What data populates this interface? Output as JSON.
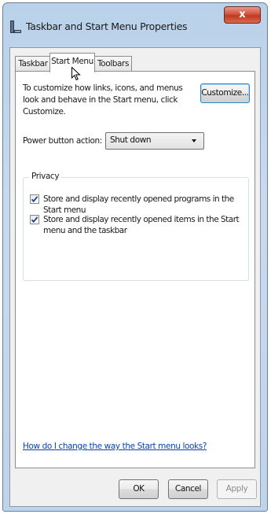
{
  "window": {
    "title": "Taskbar and Start Menu Properties",
    "close_label": "x"
  },
  "tabs": [
    {
      "label": "Taskbar",
      "active": false
    },
    {
      "label": "Start Menu",
      "active": true
    },
    {
      "label": "Toolbars",
      "active": false
    }
  ],
  "start_menu": {
    "description": "To customize how links, icons, and menus look and behave in the Start menu, click Customize.",
    "customize_label": "Customize...",
    "power_label": "Power button action:",
    "power_value": "Shut down",
    "privacy": {
      "legend": "Privacy",
      "options": [
        {
          "label": "Store and display recently opened programs in the Start menu",
          "checked": true
        },
        {
          "label": "Store and display recently opened items in the Start menu and the taskbar",
          "checked": true
        }
      ]
    },
    "help_link": "How do I change the way the Start menu looks?"
  },
  "footer": {
    "ok_label": "OK",
    "cancel_label": "Cancel",
    "apply_label": "Apply"
  },
  "colors": {
    "link": "#0645ad",
    "close_button": "#c0391f",
    "titlebar": "#b9d1ea"
  }
}
